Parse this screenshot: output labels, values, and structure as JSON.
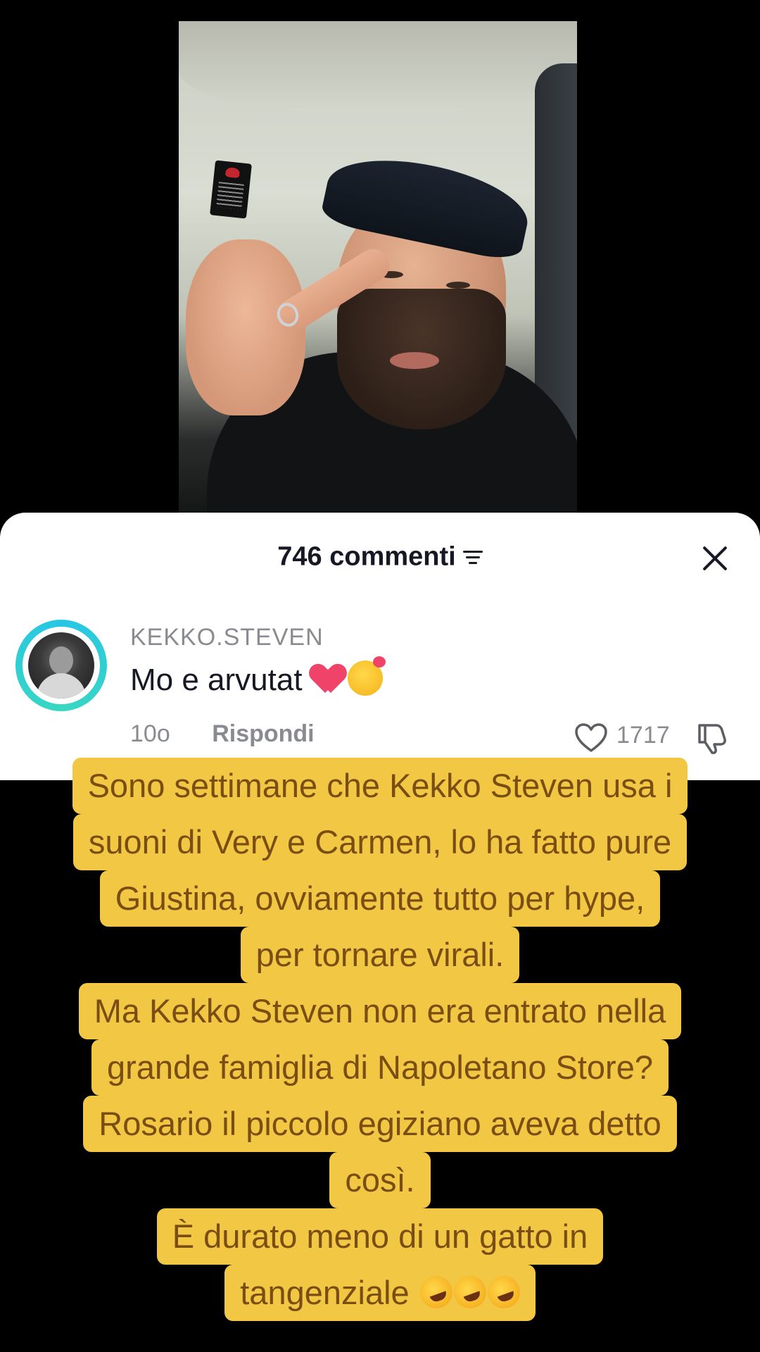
{
  "sheet": {
    "comment_count_label": "746 commenti"
  },
  "comment": {
    "username": "KEKKO.STEVEN",
    "text": "Mo e arvutat",
    "emojis": [
      "heart-emoji",
      "smiling-face-with-hearts-emoji"
    ],
    "time": "10o",
    "reply_label": "Rispondi",
    "likes": "1717"
  },
  "caption": {
    "lines": [
      "Sono settimane che Kekko Steven usa i",
      "suoni di Very e Carmen, lo ha fatto pure",
      "Giustina, ovviamente tutto per hype,",
      "per tornare virali.",
      "Ma Kekko Steven non era entrato nella",
      "grande famiglia di Napoletano Store?",
      "Rosario il piccolo egiziano aveva detto",
      "così.",
      "È durato meno di un gatto in",
      "tangenziale"
    ],
    "last_line_emoji": "rolling-on-floor-laughing-emoji x3"
  },
  "colors": {
    "caption_bg": "#f2c744",
    "caption_text": "#7a4e13",
    "avatar_ring": "#27c6e5",
    "heart_red": "#f0436a"
  }
}
